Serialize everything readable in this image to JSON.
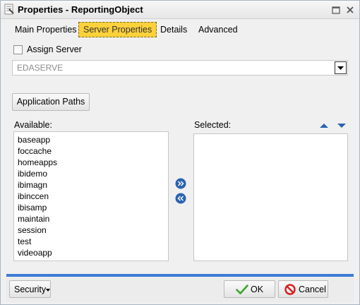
{
  "window": {
    "title": "Properties - ReportingObject"
  },
  "tabs": [
    {
      "label": "Main Properties",
      "active": false
    },
    {
      "label": "Server Properties",
      "active": true
    },
    {
      "label": "Details",
      "active": false
    },
    {
      "label": "Advanced",
      "active": false
    }
  ],
  "server": {
    "assign_label": "Assign Server",
    "assign_checked": false,
    "selected_value": "EDASERVE"
  },
  "app_paths_button": "Application Paths",
  "available": {
    "label": "Available:",
    "items": [
      "baseapp",
      "foccache",
      "homeapps",
      "ibidemo",
      "ibimagn",
      "ibinccen",
      "ibisamp",
      "maintain",
      "session",
      "test",
      "videoapp"
    ]
  },
  "selected": {
    "label": "Selected:",
    "items": []
  },
  "footer": {
    "security_label": "Security",
    "ok_label": "OK",
    "cancel_label": "Cancel"
  },
  "colors": {
    "active_tab": "#fcd13b",
    "footer_accent": "#3d7bd6",
    "icon_blue": "#2a63b0",
    "ok_green": "#3aa52a",
    "cancel_red": "#d42020"
  },
  "icons": {
    "title": "properties-icon",
    "maximize": "maximize-icon",
    "close": "close-icon",
    "dropdown": "chevron-down-icon",
    "move_up": "arrow-up-icon",
    "move_down": "arrow-down-icon",
    "add": "double-chevron-right-icon",
    "remove": "double-chevron-left-icon",
    "ok": "checkmark-icon",
    "cancel": "no-entry-icon"
  }
}
